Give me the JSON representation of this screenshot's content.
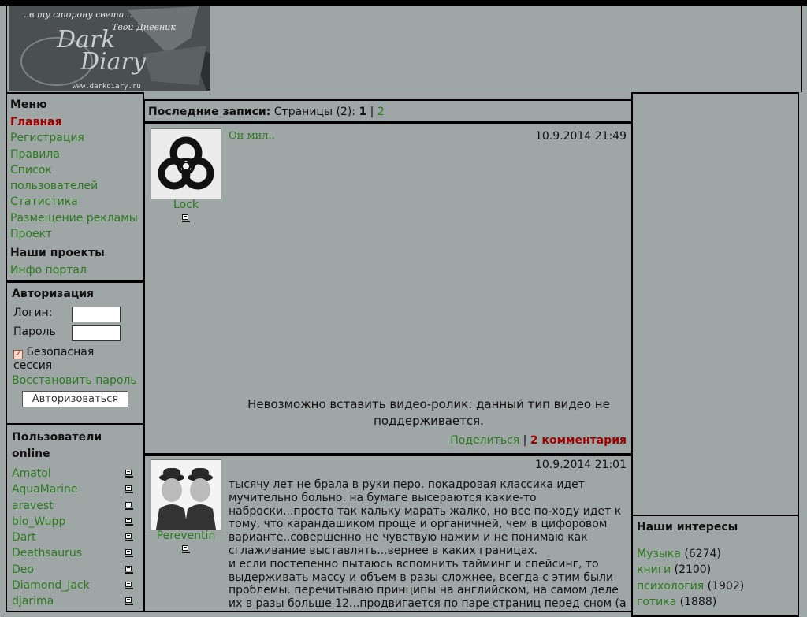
{
  "header": {
    "logo_text": [
      "..в ту сторону света...",
      "Твой Дневник",
      "Dark",
      "Diary",
      "www.darkdiary.ru"
    ]
  },
  "menu": {
    "title": "Меню",
    "items": [
      {
        "label": "Главная",
        "active": true
      },
      {
        "label": "Регистрация"
      },
      {
        "label": "Правила"
      },
      {
        "label": "Список"
      },
      {
        "label": "пользователей"
      },
      {
        "label": "Статистика"
      },
      {
        "label": "Размещение рекламы"
      },
      {
        "label": "Проект"
      }
    ],
    "projects_title": "Наши проекты",
    "projects": [
      {
        "label": "Инфо портал"
      }
    ]
  },
  "auth": {
    "title": "Авторизация",
    "login_label": "Логин:",
    "password_label": "Пароль",
    "secure_label_1": "Безопасная",
    "secure_label_2": "сессия",
    "restore_label": "Восстановить пароль",
    "submit_label": "Авторизоваться"
  },
  "online": {
    "title_1": "Пользователи",
    "title_2": "online",
    "users": [
      "Amatol",
      "AquaMarine",
      "aravest",
      "blo_Wupp",
      "Dart",
      "Deathsaurus",
      "Deo",
      "Diamond_Jack",
      "djarima"
    ]
  },
  "main": {
    "heading_bold": "Последние записи:",
    "heading_pages": "Страницы (2):",
    "page_current": "1",
    "page_sep": "|",
    "page_next": "2"
  },
  "posts": [
    {
      "author": "Lock",
      "date": "10.9.2014 21:49",
      "title": "Он мил..",
      "body_1": "Невозможно вставить видео-ролик: данный тип видео не",
      "body_2": "поддерживается.",
      "share_label": "Поделиться",
      "comments_label": "2 комментария"
    },
    {
      "author": "Pereventin",
      "date": "10.9.2014 21:01",
      "lines": [
        "тысячу лет не брала в руки перо. покадровая классика идет",
        "мучительно больно. на бумаге высераются какие-то",
        "наброски...просто так кальку марать жалко, но все по-ходу идет к",
        "тому, что карандашиком проще и органичней, чем в цифоровом",
        "варианте..совершенно не чувствую нажим и не понимаю как",
        "сглаживание выставлять...вернее в каких границах.",
        "и если постепенно пытаюсь вспомнить тайминг и спейсинг, то",
        "выдерживать массу и объем в разы сложнее, всегда с этим были",
        "проблемы. перечитываю принципы на английском, на самом деле",
        "их в разы больше 12...продвигается по паре страниц перед сном (а"
      ]
    }
  ],
  "interests": {
    "title": "Наши интересы",
    "items": [
      {
        "label": "Музыка",
        "count": "(6274)"
      },
      {
        "label": "книги",
        "count": "(2100)"
      },
      {
        "label": "психология",
        "count": "(1902)"
      },
      {
        "label": "готика",
        "count": "(1888)"
      }
    ]
  },
  "colors": {
    "background": "#9fa6a6",
    "link": "#2b7a1e",
    "active": "#a00000"
  }
}
